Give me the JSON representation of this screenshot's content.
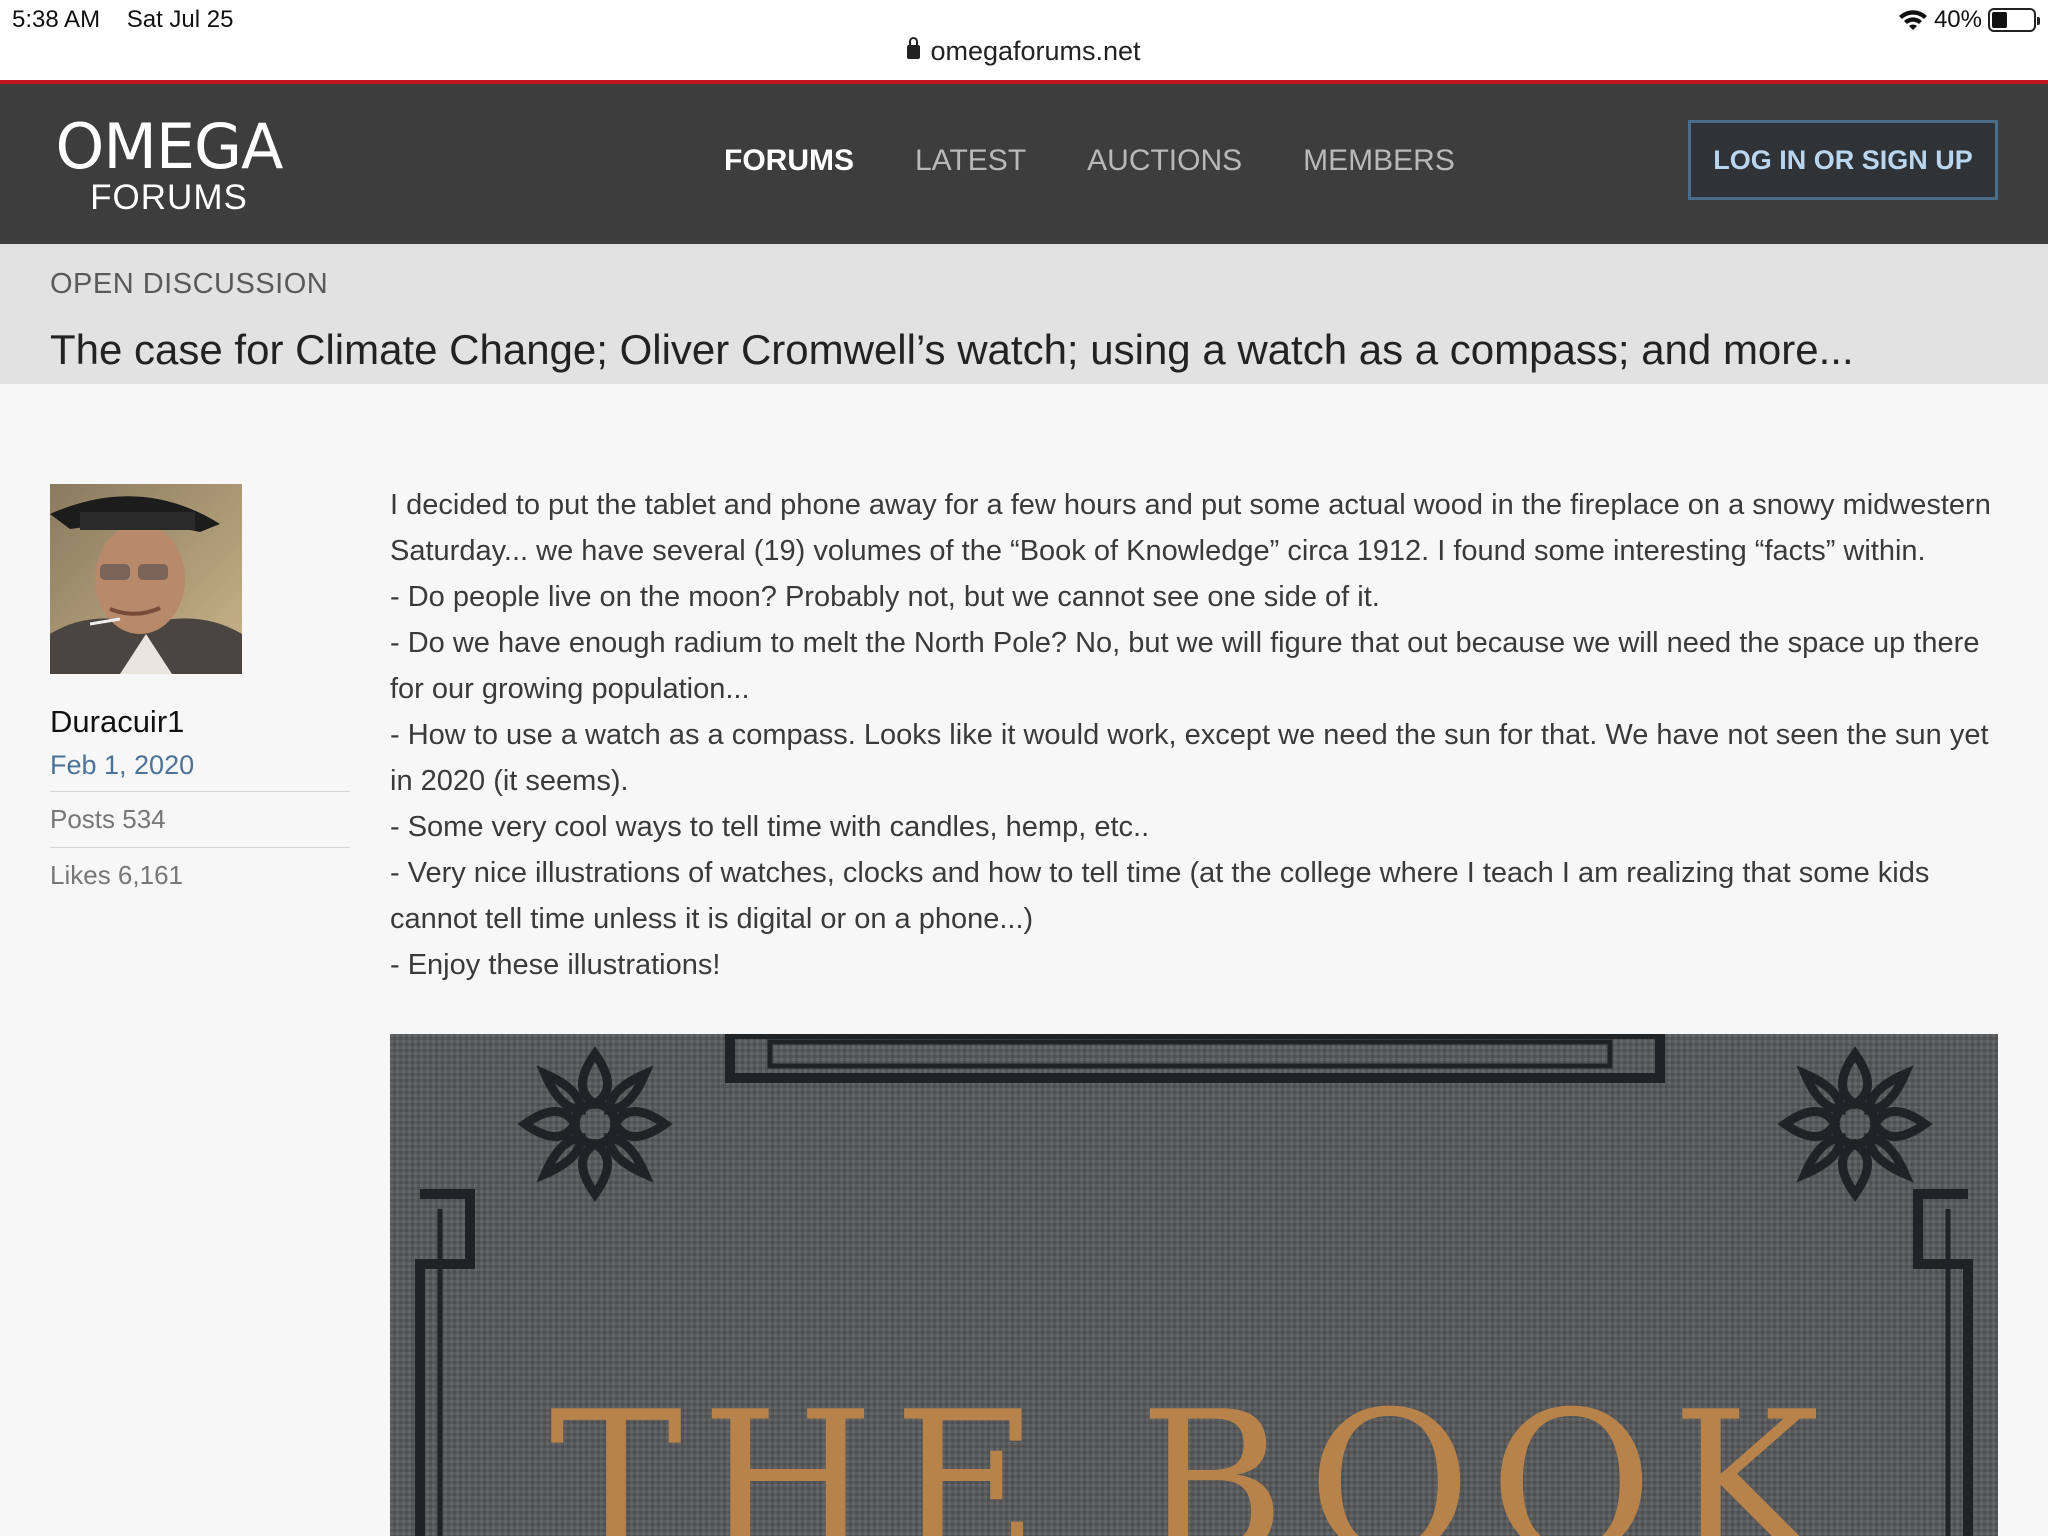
{
  "status_bar": {
    "time": "5:38 AM",
    "date": "Sat Jul 25",
    "battery_text": "40%",
    "battery_level": 0.4,
    "icons": [
      "wifi-icon",
      "battery-icon"
    ]
  },
  "browser": {
    "url": "omegaforums.net",
    "icon": "lock-icon"
  },
  "header": {
    "logo_line1": "OMEGA",
    "logo_line2": "FORUMS",
    "nav": [
      {
        "label": "FORUMS",
        "active": true
      },
      {
        "label": "LATEST",
        "active": false
      },
      {
        "label": "AUCTIONS",
        "active": false
      },
      {
        "label": "MEMBERS",
        "active": false
      }
    ],
    "login_label": "LOG IN OR SIGN UP",
    "accent_color": "#c0171d",
    "background_color": "#3d3d3d"
  },
  "thread": {
    "breadcrumb": "OPEN DISCUSSION",
    "title": "The case for Climate Change; Oliver Cromwell’s watch; using a watch as a compass; and more..."
  },
  "post": {
    "author": "Duracuir1",
    "date": "Feb 1, 2020",
    "posts_label": "Posts 534",
    "likes_label": "Likes 6,161",
    "paragraphs": [
      "I decided to put the tablet and phone away for a few hours and put some actual wood in the fireplace on a snowy midwestern Saturday... we have several (19) volumes of the “Book of Knowledge” circa 1912. I found some interesting “facts” within.",
      "- Do people live on the moon? Probably not, but we cannot see one side of it.",
      "- Do we have enough radium to melt the North Pole? No, but we will figure that out because we will need the space up there for our growing population...",
      "- How to use a watch as a compass. Looks like it would work, except we need the sun for that. We have not seen the sun yet in 2020 (it seems).",
      "- Some very cool ways to tell time with candles, hemp, etc..",
      "- Very nice illustrations of watches, clocks and how to tell time (at the college where I teach I am realizing that some kids cannot tell time unless it is digital or on a phone...)",
      "- Enjoy these illustrations!"
    ],
    "image_text": "THE BOOK"
  }
}
